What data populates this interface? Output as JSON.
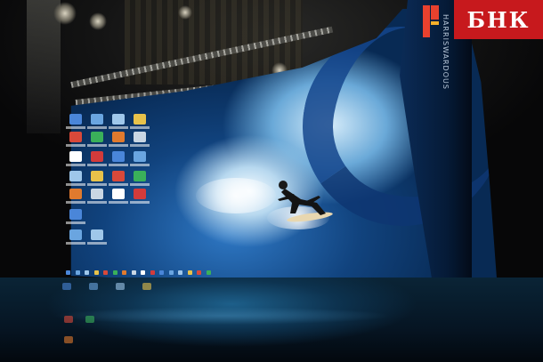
{
  "watermark": {
    "label": "БНК",
    "color": "#c7191d"
  },
  "screen": {
    "vertical_caption": "HARRISWARDOUS",
    "palette": {
      "ocean_deep": "#082a54",
      "ocean_mid": "#2f79c6",
      "foam": "#f4fbff"
    }
  },
  "desktop_icons": [
    {
      "icon": "computer-icon",
      "color": "#4a86d9"
    },
    {
      "icon": "network-icon",
      "color": "#6aa5e0"
    },
    {
      "icon": "recycle-bin-icon",
      "color": "#9fc7ea"
    },
    {
      "icon": "folder-icon",
      "color": "#e8c24a"
    },
    {
      "icon": "chrome-icon",
      "color": "#d9493a"
    },
    {
      "icon": "app-icon",
      "color": "#3ab05a"
    },
    {
      "icon": "media-icon",
      "color": "#e07a2e"
    },
    {
      "icon": "settings-icon",
      "color": "#c9d6e3"
    },
    {
      "icon": "document-icon",
      "color": "#ffffff"
    },
    {
      "icon": "video-icon",
      "color": "#d33b3b"
    }
  ]
}
